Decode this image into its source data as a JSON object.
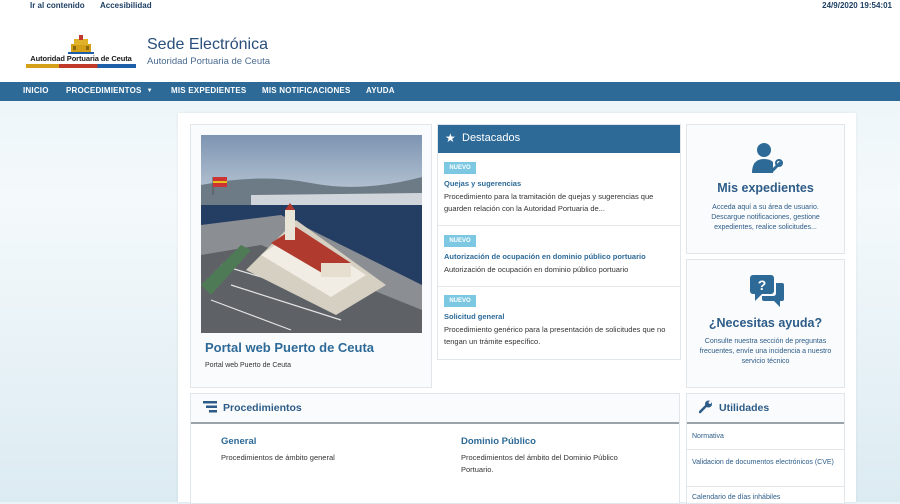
{
  "topbar": {
    "skip_link": "Ir al contenido",
    "accessibility_link": "Accesibilidad",
    "datetime": "24/9/2020 19:54:01"
  },
  "header": {
    "logo_text": "Autoridad Portuaria de Ceuta",
    "title": "Sede Electrónica",
    "subtitle": "Autoridad Portuaria de Ceuta"
  },
  "nav": {
    "items": [
      "INICIO",
      "PROCEDIMIENTOS",
      "MIS EXPEDIENTES",
      "MIS NOTIFICACIONES",
      "AYUDA"
    ]
  },
  "portal": {
    "title": "Portal web Puerto de Ceuta",
    "description": "Portal web Puerto de Ceuta"
  },
  "destacados": {
    "title": "Destacados",
    "items": [
      {
        "badge": "NUEVO",
        "title": "Quejas y sugerencias",
        "description": "Procedimiento para la tramitación de quejas y sugerencias que guarden relación con la Autoridad Portuaria de..."
      },
      {
        "badge": "NUEVO",
        "title": "Autorización de ocupación en dominio público portuario",
        "description": "Autorización de ocupación en dominio público portuario"
      },
      {
        "badge": "NUEVO",
        "title": "Solicitud general",
        "description": "Procedimiento genérico para la presentación de solicitudes que no tengan un trámite específico."
      }
    ]
  },
  "expedientes": {
    "title": "Mis expedientes",
    "description": "Acceda aquí a su área de usuario. Descargue notificaciones, gestione expedientes, realice solicitudes..."
  },
  "ayuda": {
    "title": "¿Necesitas ayuda?",
    "description": "Consulte nuestra sección de preguntas frecuentes, envíe una incidencia a nuestro servicio técnico"
  },
  "procedimientos": {
    "title": "Procedimientos",
    "items": [
      {
        "name": "General",
        "description": "Procedimientos de ámbito general"
      },
      {
        "name": "Dominio Público",
        "description": "Procedimientos del ámbito del Dominio Público Portuario."
      }
    ]
  },
  "utilidades": {
    "title": "Utilidades",
    "links": [
      "Normativa",
      "Validacion de documentos electrónicos (CVE)",
      "Calendario de días inhábiles"
    ]
  },
  "colors": {
    "nav_bg": "#2d6a98",
    "link_blue": "#2d6a98",
    "badge": "#7cc8e2",
    "heading_blue": "#2d5c88"
  },
  "icons": {
    "star": "star-icon",
    "user_settings": "user-gear-icon",
    "help": "help-chat-icon",
    "list": "list-icon",
    "wrench": "wrench-icon"
  }
}
